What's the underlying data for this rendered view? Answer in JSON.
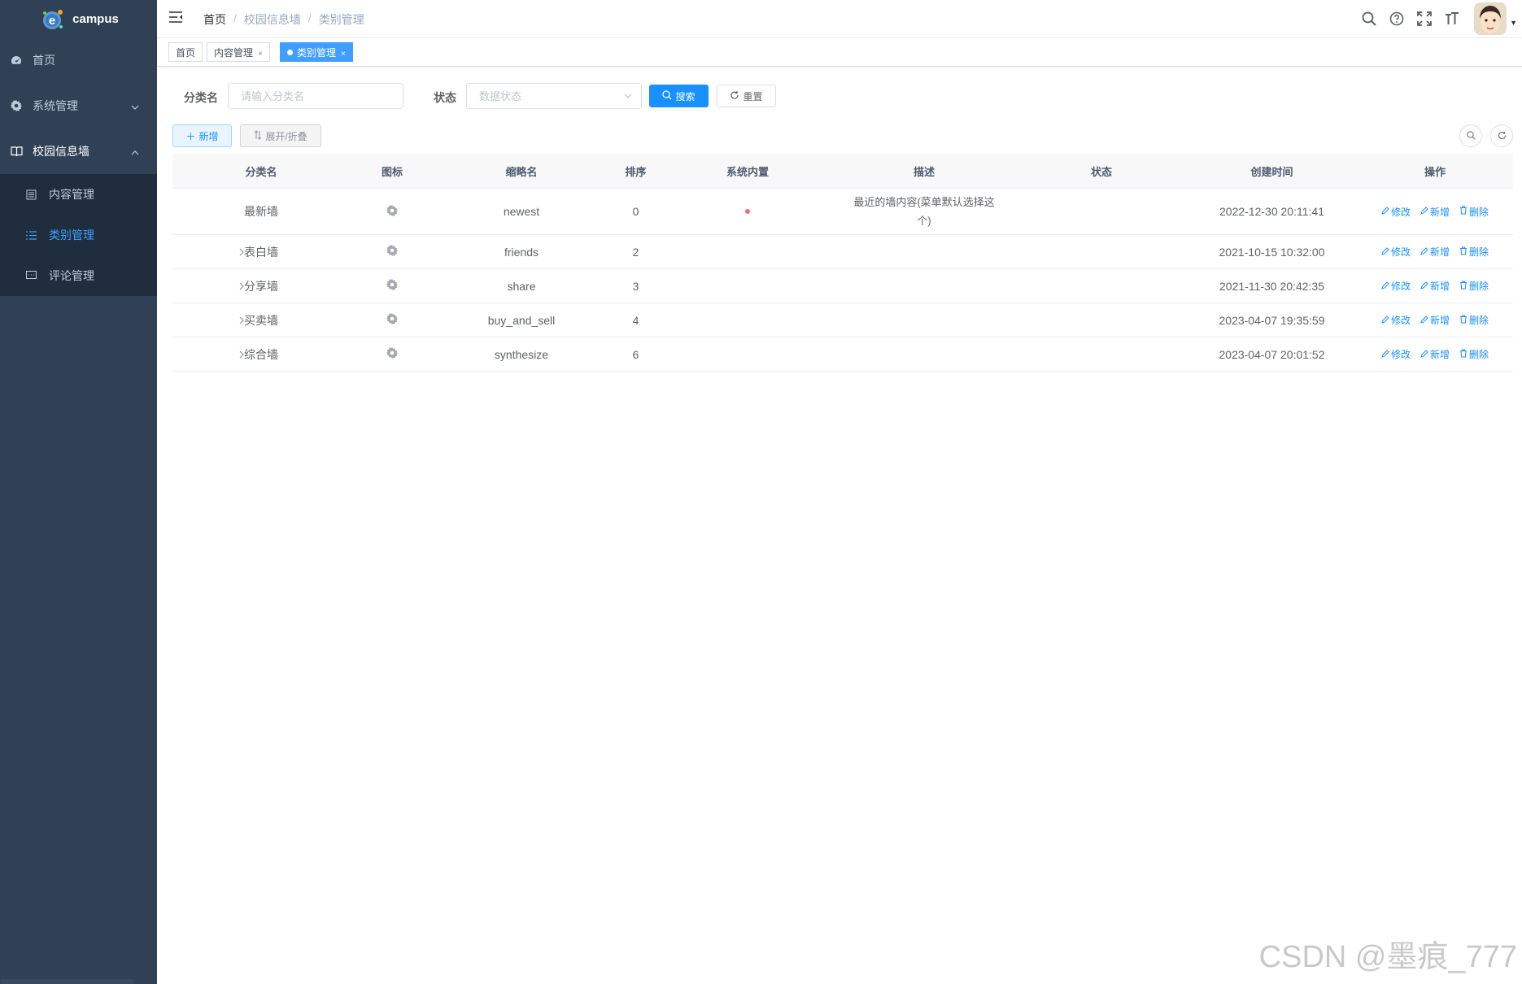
{
  "app": {
    "name": "campus"
  },
  "sidebar": {
    "items": [
      {
        "label": "首页",
        "icon": "dashboard-icon"
      },
      {
        "label": "系统管理",
        "icon": "gear-icon"
      },
      {
        "label": "校园信息墙",
        "icon": "book-icon"
      }
    ],
    "submenu": [
      {
        "label": "内容管理",
        "icon": "content-icon"
      },
      {
        "label": "类别管理",
        "icon": "list-icon",
        "active": true
      },
      {
        "label": "评论管理",
        "icon": "comment-icon"
      }
    ]
  },
  "navbar": {
    "breadcrumb": [
      "首页",
      "校园信息墙",
      "类别管理"
    ]
  },
  "tags": [
    "首页",
    "内容管理",
    "类别管理"
  ],
  "search": {
    "name_label": "分类名",
    "name_placeholder": "请输入分类名",
    "status_label": "状态",
    "status_placeholder": "数据状态",
    "search_btn": "搜索",
    "reset_btn": "重置"
  },
  "toolbar": {
    "add_btn": "新增",
    "expand_btn": "展开/折叠"
  },
  "table": {
    "columns": [
      "分类名",
      "图标",
      "缩略名",
      "排序",
      "系统内置",
      "描述",
      "状态",
      "创建时间",
      "操作"
    ],
    "rows": [
      {
        "name": "最新墙",
        "slug": "newest",
        "sort": "0",
        "builtin": true,
        "desc_line1": "最近的墙内容(菜单默认选择这",
        "desc_line2": "个)",
        "created": "2022-12-30 20:11:41",
        "expandable": false
      },
      {
        "name": "表白墙",
        "slug": "friends",
        "sort": "2",
        "builtin": false,
        "desc_line1": "",
        "desc_line2": "",
        "created": "2021-10-15 10:32:00",
        "expandable": true
      },
      {
        "name": "分享墙",
        "slug": "share",
        "sort": "3",
        "builtin": false,
        "desc_line1": "",
        "desc_line2": "",
        "created": "2021-11-30 20:42:35",
        "expandable": true
      },
      {
        "name": "买卖墙",
        "slug": "buy_and_sell",
        "sort": "4",
        "builtin": false,
        "desc_line1": "",
        "desc_line2": "",
        "created": "2023-04-07 19:35:59",
        "expandable": true
      },
      {
        "name": "综合墙",
        "slug": "synthesize",
        "sort": "6",
        "builtin": false,
        "desc_line1": "",
        "desc_line2": "",
        "created": "2023-04-07 20:01:52",
        "expandable": true
      }
    ],
    "ops": {
      "edit": "修改",
      "add": "新增",
      "delete": "删除"
    }
  },
  "watermark": "CSDN @墨痕_777",
  "colors": {
    "sidebar_bg": "#304156",
    "submenu_bg": "#1f2d3d",
    "primary": "#1890ff",
    "active_text": "#409eff"
  }
}
